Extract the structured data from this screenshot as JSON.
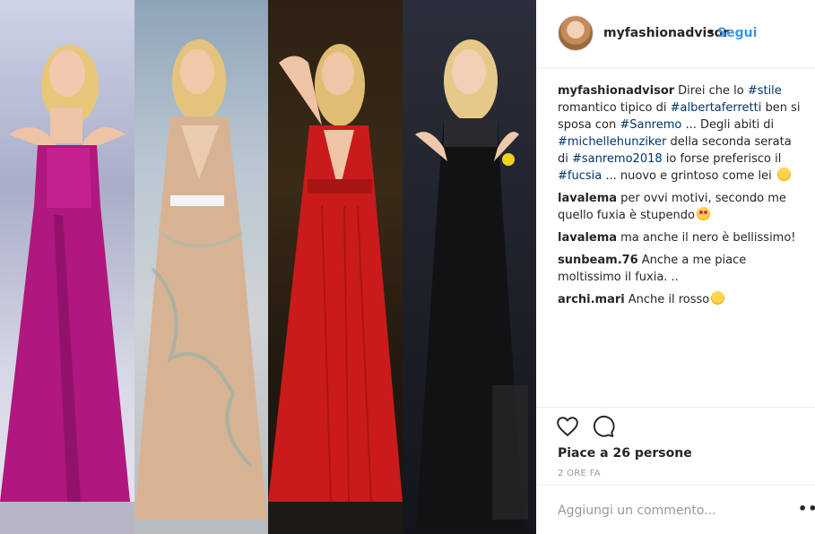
{
  "post": {
    "photo_label": "Michelle Hunziker collage",
    "panel_colors": [
      "#c21c8e",
      "#d9b89a",
      "#c81e1e",
      "#111111"
    ]
  },
  "header": {
    "username": "myfashionadvisor",
    "separator": "•",
    "follow_label": "Segui"
  },
  "caption": {
    "user": "myfashionadvisor",
    "segments": [
      {
        "t": "Direi che lo ",
        "tag": false
      },
      {
        "t": "#stile",
        "tag": true
      },
      {
        "t": " romantico tipico di ",
        "tag": false
      },
      {
        "t": "#albertaferretti",
        "tag": true
      },
      {
        "t": " ben si sposa con ",
        "tag": false
      },
      {
        "t": "#Sanremo",
        "tag": true
      },
      {
        "t": " ... Degli abiti di ",
        "tag": false
      },
      {
        "t": "#michellehunziker",
        "tag": true
      },
      {
        "t": " della seconda serata di ",
        "tag": false
      },
      {
        "t": "#sanremo2018",
        "tag": true
      },
      {
        "t": " io forse preferisco il ",
        "tag": false
      },
      {
        "t": "#fucsia",
        "tag": true
      },
      {
        "t": " ... nuovo e grintoso come lei ",
        "tag": false
      }
    ],
    "emoji": "smile-emoji"
  },
  "comments": [
    {
      "user": "lavalema",
      "text": "per ovvi motivi, secondo me quello fuxia è stupendo",
      "emoji": "heart-eyes-emoji"
    },
    {
      "user": "lavalema",
      "text": "ma anche il nero è bellissimo!",
      "emoji": ""
    },
    {
      "user": "sunbeam.76",
      "text": "Anche a me piace moltissimo il fuxia. ..",
      "emoji": ""
    },
    {
      "user": "archi.mari",
      "text": "Anche il rosso",
      "emoji": "smile-emoji"
    }
  ],
  "actions": {
    "like_icon": "heart-icon",
    "comment_icon": "comment-icon",
    "likes_text": "Piace a 26 persone",
    "time_text": "2 ORE FA"
  },
  "footer": {
    "add_comment_placeholder": "Aggiungi un commento...",
    "more_label": "•••"
  }
}
